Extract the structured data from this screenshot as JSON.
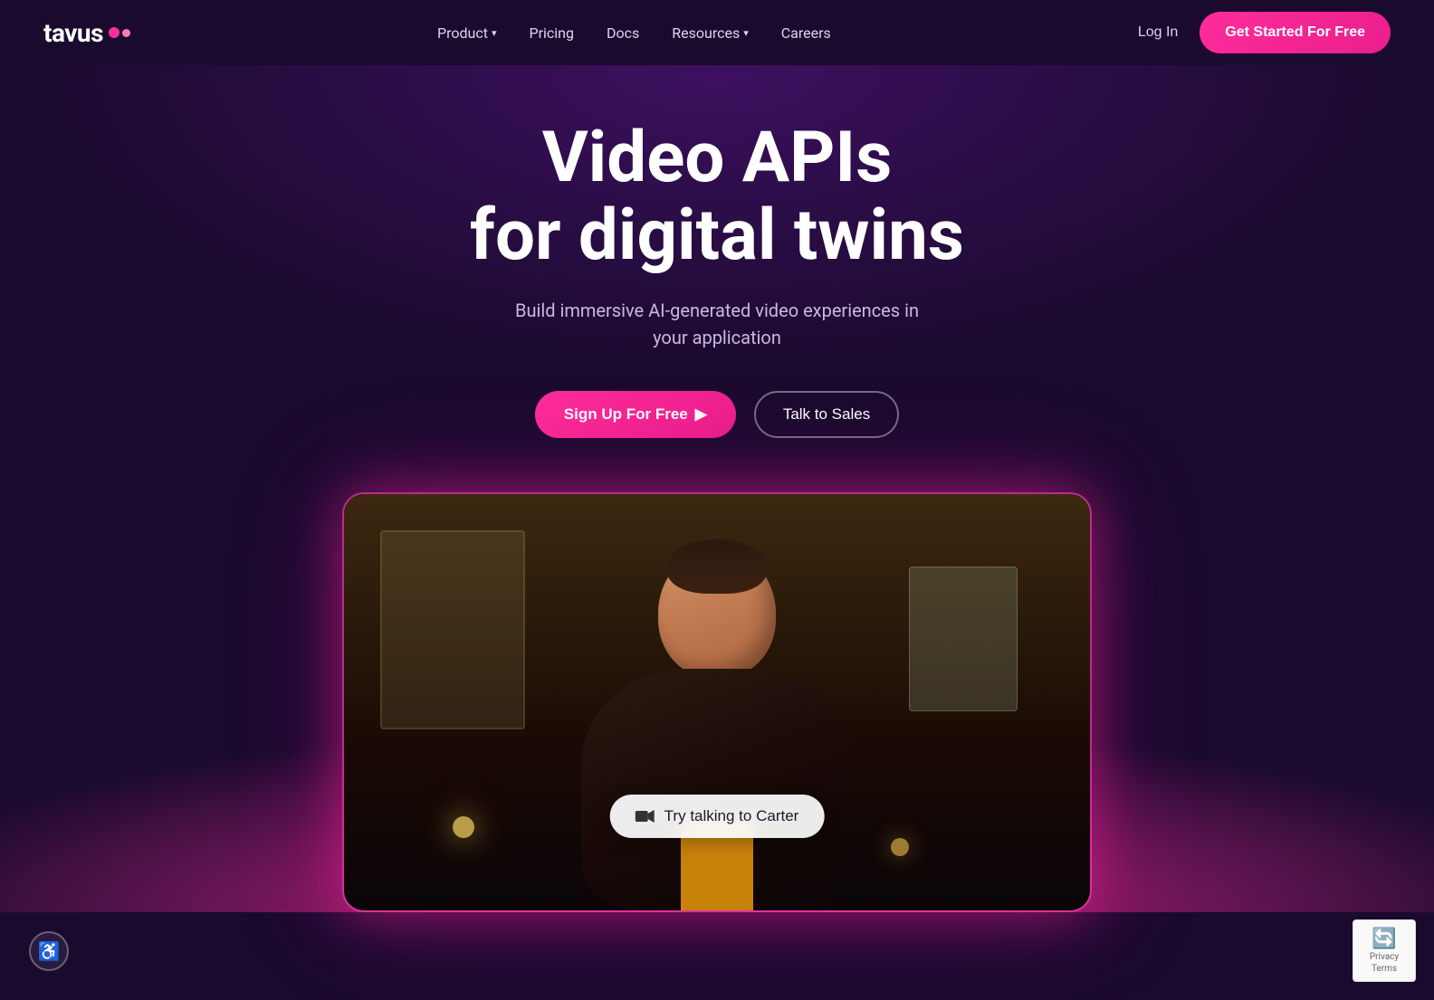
{
  "logo": {
    "text": "tavus",
    "aria": "Tavus logo"
  },
  "nav": {
    "links": [
      {
        "label": "Product",
        "hasDropdown": true
      },
      {
        "label": "Pricing",
        "hasDropdown": false
      },
      {
        "label": "Docs",
        "hasDropdown": false
      },
      {
        "label": "Resources",
        "hasDropdown": true
      },
      {
        "label": "Careers",
        "hasDropdown": false
      }
    ],
    "login_label": "Log In",
    "cta_label": "Get Started For Free"
  },
  "hero": {
    "title_line1": "Video APIs",
    "title_line2": "for digital twins",
    "subtitle": "Build immersive AI-generated video experiences in your application",
    "btn_signup": "Sign Up For Free",
    "btn_signup_arrow": "▶",
    "btn_sales": "Talk to Sales"
  },
  "video": {
    "try_talking_label": "Try talking to Carter"
  },
  "accessibility": {
    "btn_aria": "Accessibility options"
  },
  "recaptcha": {
    "line1": "Privacy",
    "line2": "Terms"
  },
  "colors": {
    "brand_pink": "#ff2d9b",
    "brand_dark": "#1a0a2e",
    "nav_link": "#e0d0f0"
  }
}
